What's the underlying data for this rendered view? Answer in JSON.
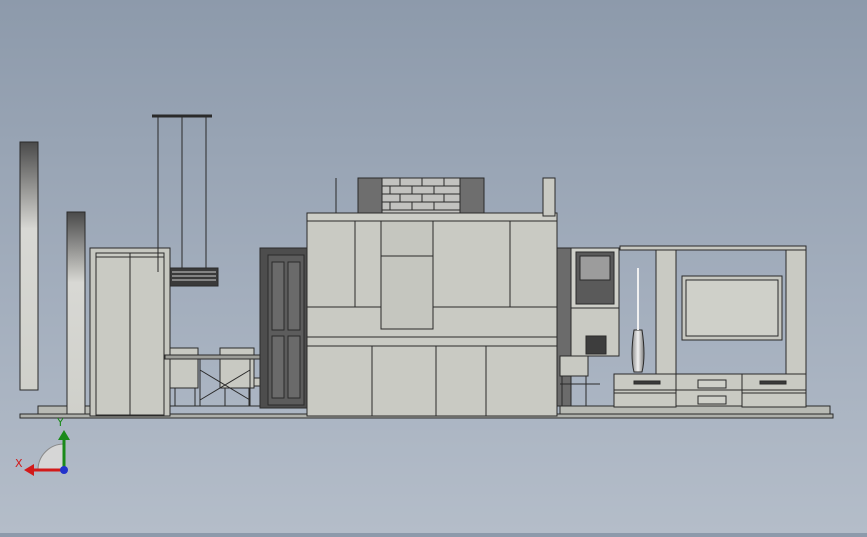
{
  "scene": {
    "view": "front elevation",
    "background": {
      "top": "#8d9aab",
      "bottom": "#b4bdc9"
    },
    "colors": {
      "outline": "#2a2a2a",
      "fill_light": "#c9cac3",
      "fill_mid": "#b9bab3",
      "fill_dark": "#4d4d4d",
      "brick": "#c2c2bf",
      "brick_dark": "#6e6e6e",
      "floor": "#aeb0ab"
    }
  },
  "axis_triad": {
    "x_label": "X",
    "y_label": "Y",
    "x_color": "#d21a1a",
    "y_color": "#1a8a1a",
    "z_color": "#2233cc"
  }
}
